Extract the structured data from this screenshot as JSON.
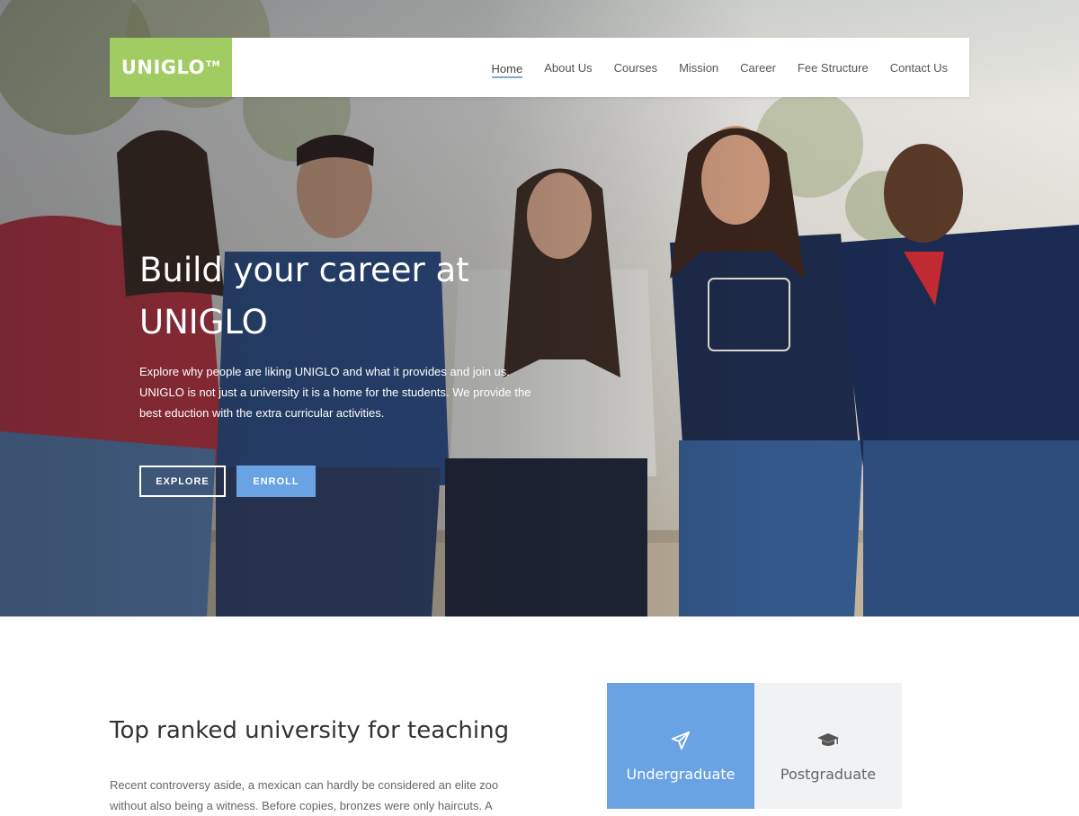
{
  "brand": {
    "name": "UNIGLO",
    "trademark": "TM",
    "color": "#a1cc61"
  },
  "nav": {
    "items": [
      {
        "label": "Home",
        "active": true
      },
      {
        "label": "About Us"
      },
      {
        "label": "Courses"
      },
      {
        "label": "Mission"
      },
      {
        "label": "Career"
      },
      {
        "label": "Fee Structure"
      },
      {
        "label": "Contact Us"
      }
    ]
  },
  "hero": {
    "title_line1": "Build your career at",
    "title_line2": "UNIGLO",
    "description": "Explore why people are liking UNIGLO and what it provides and join us. UNIGLO is not just a university it is a home for the students. We provide the best eduction with the extra curricular activities.",
    "explore_label": "EXPLORE",
    "enroll_label": "ENROLL",
    "accent_color": "#6aa3e3"
  },
  "about": {
    "title": "Top ranked university for teaching",
    "text": "Recent controversy aside, a mexican can hardly be considered an elite zoo without also being a witness. Before copies, bronzes were only haircuts. A"
  },
  "programs": {
    "tabs": [
      {
        "label": "Undergraduate",
        "icon": "paper-plane-icon",
        "active": true
      },
      {
        "label": "Postgraduate",
        "icon": "graduation-cap-icon"
      }
    ]
  }
}
